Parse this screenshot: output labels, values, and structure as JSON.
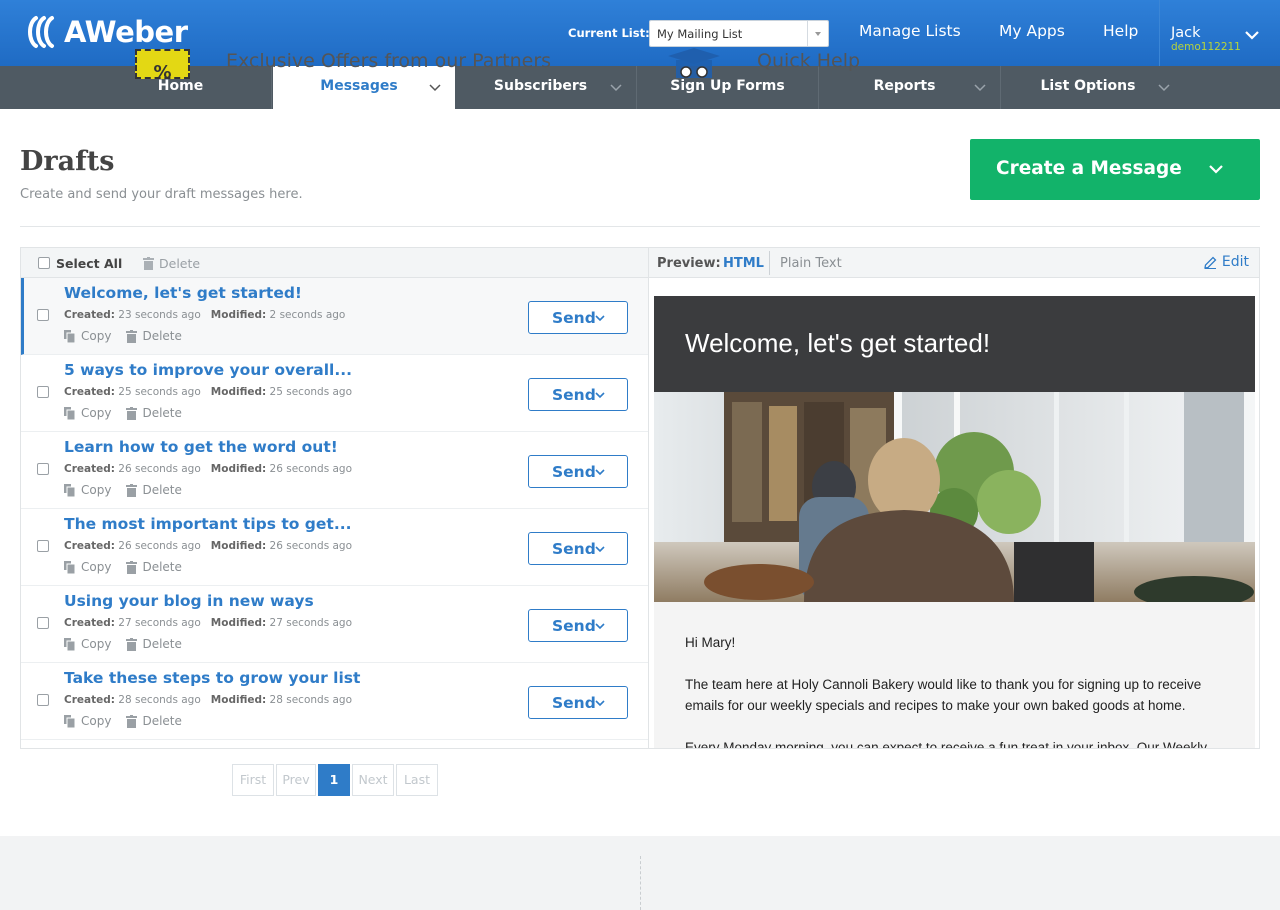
{
  "header": {
    "logo_text": "AWeber",
    "current_list_label": "Current List:",
    "current_list_value": "My Mailing List",
    "links": [
      "Manage Lists",
      "My Apps",
      "Help"
    ],
    "user": {
      "name": "Jack",
      "id": "demo112211"
    }
  },
  "nav": {
    "items": [
      {
        "label": "Home"
      },
      {
        "label": "Messages"
      },
      {
        "label": "Subscribers"
      },
      {
        "label": "Sign Up Forms"
      },
      {
        "label": "Reports"
      },
      {
        "label": "List Options"
      }
    ]
  },
  "page": {
    "title": "Drafts",
    "subtitle": "Create and send your draft messages here.",
    "create_button": "Create a Message"
  },
  "list_toolbar": {
    "select_all": "Select All",
    "delete": "Delete"
  },
  "row_labels": {
    "created": "Created:",
    "modified": "Modified:",
    "copy": "Copy",
    "delete": "Delete",
    "send": "Send"
  },
  "drafts": [
    {
      "title": "Welcome, let's get started!",
      "created": "23 seconds ago",
      "modified": "2 seconds ago"
    },
    {
      "title": "5 ways to improve your overall...",
      "created": "25 seconds ago",
      "modified": "25 seconds ago"
    },
    {
      "title": "Learn how to get the word out!",
      "created": "26 seconds ago",
      "modified": "26 seconds ago"
    },
    {
      "title": "The most important tips to get...",
      "created": "26 seconds ago",
      "modified": "26 seconds ago"
    },
    {
      "title": "Using your blog in new ways",
      "created": "27 seconds ago",
      "modified": "27 seconds ago"
    },
    {
      "title": "Take these steps to grow your list",
      "created": "28 seconds ago",
      "modified": "28 seconds ago"
    }
  ],
  "preview": {
    "label": "Preview:",
    "html_tab": "HTML",
    "plain_tab": "Plain Text",
    "edit": "Edit",
    "email_title": "Welcome, let's get started!",
    "greeting": "Hi Mary!",
    "paragraph1": "The team here at Holy Cannoli Bakery would like to thank you for signing up to receive emails for our weekly specials and recipes to make your own baked goods at home.",
    "paragraph2": "Every Monday morning, you can expect to receive a fun treat in your inbox. Our Weekly"
  },
  "pagination": {
    "first": "First",
    "prev": "Prev",
    "current": "1",
    "next": "Next",
    "last": "Last"
  },
  "footer": {
    "offers_title": "Exclusive Offers from our Partners",
    "offers_icon_text": "%",
    "help_title": "Quick Help"
  },
  "colors": {
    "brand_blue": "#2f7cc8",
    "nav_bg": "#4f5a63",
    "create_green": "#12b36a"
  }
}
